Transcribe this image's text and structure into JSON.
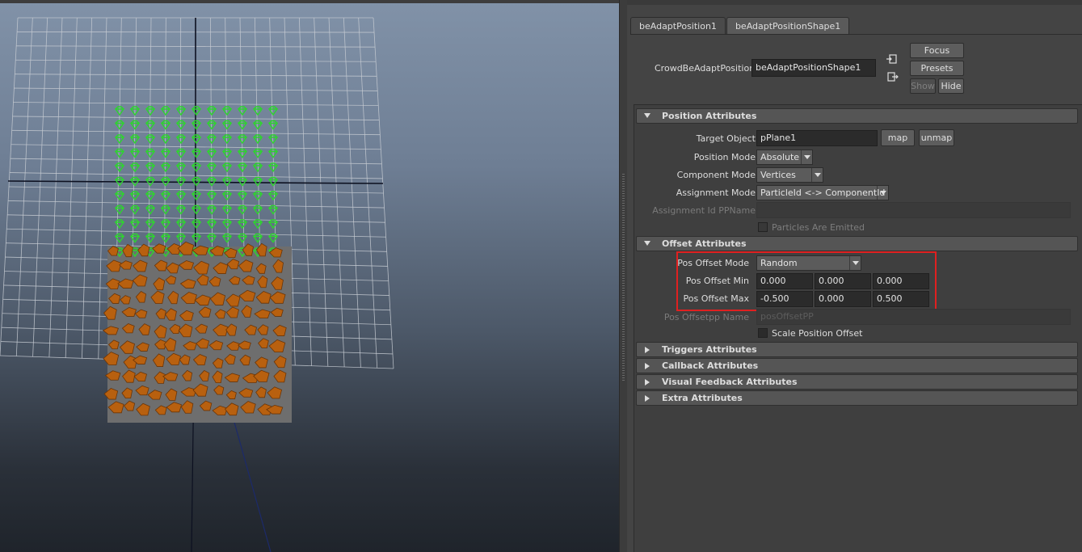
{
  "editor": {
    "tabs": [
      {
        "label": "beAdaptPosition1"
      },
      {
        "label": "beAdaptPositionShape1"
      }
    ],
    "node_label": "CrowdBeAdaptPosition:",
    "node_value": "beAdaptPositionShape1",
    "buttons": {
      "focus": "Focus",
      "presets": "Presets",
      "show": "Show",
      "hide": "Hide"
    }
  },
  "position_attributes": {
    "title": "Position Attributes",
    "target_object_label": "Target Object",
    "target_object_value": "pPlane1",
    "map_label": "map",
    "unmap_label": "unmap",
    "position_mode_label": "Position Mode",
    "position_mode_value": "Absolute",
    "component_mode_label": "Component Mode",
    "component_mode_value": "Vertices",
    "assignment_mode_label": "Assignment Mode",
    "assignment_mode_value": "ParticleId <-> ComponentId",
    "assignment_pp_label": "Assignment Id PPName",
    "assignment_pp_value": "",
    "particles_emitted_label": "Particles Are Emitted"
  },
  "offset_attributes": {
    "title": "Offset Attributes",
    "pos_offset_mode_label": "Pos Offset Mode",
    "pos_offset_mode_value": "Random",
    "pos_offset_min_label": "Pos Offset Min",
    "pos_offset_min": [
      "0.000",
      "0.000",
      "0.000"
    ],
    "pos_offset_max_label": "Pos Offset Max",
    "pos_offset_max": [
      "-0.500",
      "0.000",
      "0.500"
    ],
    "pos_offsetpp_label": "Pos Offsetpp Name",
    "pos_offsetpp_value": "posOffsetPP",
    "scale_offset_label": "Scale Position Offset"
  },
  "collapsed_sections": [
    {
      "title": "Triggers Attributes"
    },
    {
      "title": "Callback Attributes"
    },
    {
      "title": "Visual Feedback Attributes"
    },
    {
      "title": "Extra Attributes"
    }
  ],
  "colors": {
    "highlight": "#e02020",
    "agent_marker": "#2dd62d",
    "agent_body": "#b8600f"
  }
}
